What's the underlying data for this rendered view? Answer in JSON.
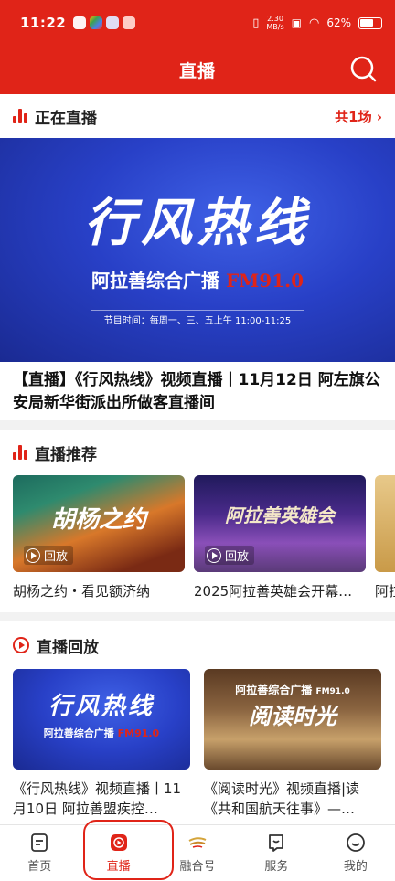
{
  "status_bar": {
    "time": "11:22",
    "speed_top": "2.30",
    "speed_unit": "MB/s",
    "battery": "62%"
  },
  "header": {
    "title": "直播"
  },
  "live_now": {
    "section_title": "正在直播",
    "more_label": "共1场",
    "banner_title": "行风热线",
    "banner_subtitle": "阿拉善综合广播",
    "banner_freq": "FM91.0",
    "banner_time": "节目时间：每周一、三、五上午 11:00-11:25",
    "caption": "【直播】《行风热线》视频直播丨11月12日 阿左旗公安局新华街派出所做客直播间"
  },
  "recommend": {
    "section_title": "直播推荐",
    "items": [
      {
        "thumb_title": "胡杨之约",
        "badge": "回放",
        "label": "胡杨之约・看见额济纳"
      },
      {
        "thumb_title": "阿拉善英雄会",
        "badge": "回放",
        "label": "2025阿拉善英雄会开幕…"
      },
      {
        "thumb_title": "",
        "badge": "",
        "label": "阿拉"
      }
    ]
  },
  "replay": {
    "section_title": "直播回放",
    "items": [
      {
        "thumb_title": "行风热线",
        "thumb_sub": "阿拉善综合广播",
        "thumb_freq": "FM91.0",
        "label": "《行风热线》视频直播丨11月10日 阿拉善盟疾控…"
      },
      {
        "thumb_title": "阅读时光",
        "thumb_sub": "阿拉善综合广播",
        "thumb_freq": "FM91.0",
        "label": "《阅读时光》视频直播|读《共和国航天往事》—…"
      }
    ]
  },
  "tabbar": {
    "items": [
      {
        "label": "首页",
        "icon": "home-doc-icon"
      },
      {
        "label": "直播",
        "icon": "live-play-icon"
      },
      {
        "label": "融合号",
        "icon": "fusion-logo-icon"
      },
      {
        "label": "服务",
        "icon": "service-icon"
      },
      {
        "label": "我的",
        "icon": "smile-icon"
      }
    ],
    "active": "直播"
  },
  "colors": {
    "brand": "#e02418",
    "banner_blue": "#2840c7"
  }
}
